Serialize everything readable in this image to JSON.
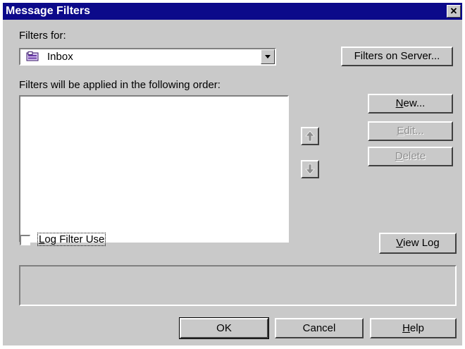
{
  "window": {
    "title": "Message Filters",
    "close_glyph": "✕"
  },
  "filters_for": {
    "label": "Filters for:",
    "selected_folder": "Inbox",
    "folder_icon": "inbox-folder-icon"
  },
  "order_label": "Filters will be applied in the following order:",
  "buttons": {
    "filters_on_server": "Filters on Server...",
    "new": {
      "mnemonic": "N",
      "rest": "ew..."
    },
    "edit": {
      "mnemonic": "E",
      "rest": "dit..."
    },
    "delete": {
      "mnemonic": "D",
      "rest": "elete"
    },
    "view_log": {
      "mnemonic": "V",
      "rest": "iew Log"
    },
    "ok": "OK",
    "cancel": "Cancel",
    "help": {
      "mnemonic": "H",
      "rest": "elp"
    }
  },
  "move_buttons": {
    "up_icon": "arrow-up-icon",
    "down_icon": "arrow-down-icon"
  },
  "log_filter": {
    "mnemonic": "L",
    "rest": "og Filter Use",
    "checked": false
  },
  "filter_list": [],
  "status_text": "",
  "colors": {
    "titlebar": "#0c0a8a",
    "dialog_face": "#c9c9c9",
    "disabled_text": "#8e8e8e"
  }
}
